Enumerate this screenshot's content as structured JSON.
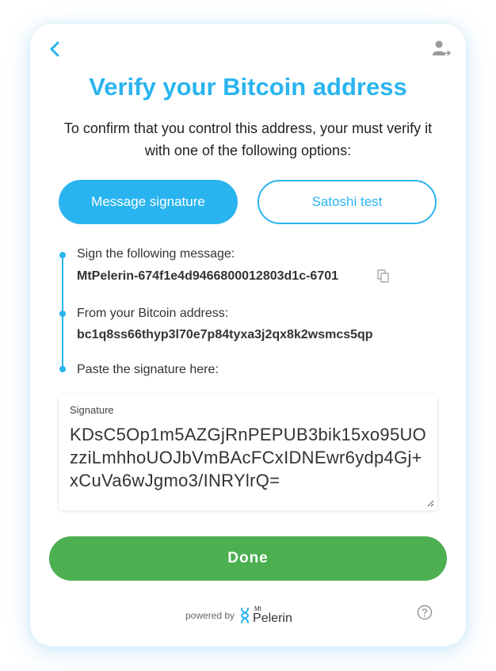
{
  "header": {
    "back_icon": "chevron-left-icon",
    "account_icon": "user-arrow-icon"
  },
  "title": "Verify your Bitcoin address",
  "subtitle": "To confirm that you control this address, your must verify it with one of the following options:",
  "tabs": [
    {
      "label": "Message signature",
      "active": true
    },
    {
      "label": "Satoshi test",
      "active": false
    }
  ],
  "steps": {
    "sign_label": "Sign the following message:",
    "message": "MtPelerin-674f1e4d9466800012803d1c-6701",
    "address_label": "From your Bitcoin address:",
    "address": "bc1q8ss66thyp3l70e7p84tyxa3j2qx8k2wsmcs5qp",
    "paste_label": "Paste the signature here:"
  },
  "signature": {
    "label": "Signature",
    "value": "KDsC5Op1m5AZGjRnPEPUB3bik15xo95UOzziLmhhoUOJbVmBAcFCxIDNEwr6ydp4Gj+xCuVa6wJgmo3/INRYlrQ="
  },
  "done_label": "Done",
  "footer": {
    "powered_by": "powered by",
    "brand_mt": "Mt",
    "brand_name": "Pelerin",
    "help_icon": "question-circle-icon"
  },
  "colors": {
    "accent": "#2ab4ef",
    "success": "#4caf50"
  }
}
